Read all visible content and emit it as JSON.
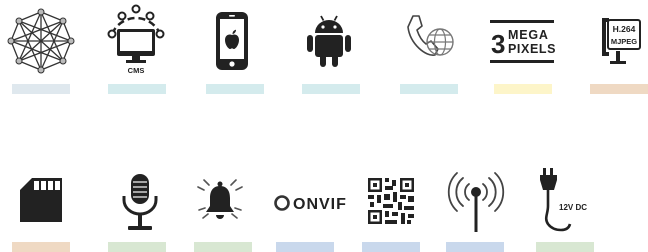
{
  "row1": {
    "cms_label": "CMS",
    "mega_number": "3",
    "mega_line1": "MEGA",
    "mega_line2": "PIXELS",
    "codec_line1": "H.264",
    "codec_line2": "MJPEG"
  },
  "row2": {
    "onvif_label": "ONVIF",
    "power_label": "12V DC"
  },
  "colors": {
    "bar_blue_gray": "#dfe8ee",
    "bar_teal": "#d4ebed",
    "bar_yellow": "#fdf5c9",
    "bar_tan": "#efd9c3",
    "bar_green": "#d8e7d2",
    "bar_blue": "#c9d8ec",
    "icon": "#222222"
  },
  "icons": [
    "network-mesh-icon",
    "cms-monitor-icon",
    "apple-phone-icon",
    "android-icon",
    "phone-web-icon",
    "megapixels-icon",
    "codec-clamp-icon",
    "sd-card-icon",
    "microphone-icon",
    "alarm-bell-icon",
    "onvif-logo",
    "qr-code-icon",
    "wireless-antenna-icon",
    "power-plug-icon"
  ]
}
